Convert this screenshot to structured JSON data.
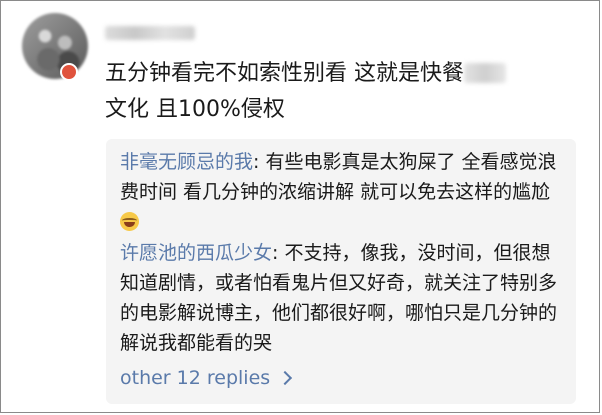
{
  "comment": {
    "text_part1": "五分钟看完不如索性别看 这就是快餐",
    "text_part2": "文化 且100%侵权"
  },
  "replies": [
    {
      "user": "非毫无顾忌的我",
      "text": ": 有些电影真是太狗屎了 全看感觉浪费时间 看几分钟的浓缩讲解 就可以免去这样的尴尬",
      "emoji": "laughing-crying-emoji"
    },
    {
      "user": "许愿池的西瓜少女",
      "text": ": 不支持，像我，没时间，但很想知道剧情，或者怕看鬼片但又好奇，就关注了特别多的电影解说博主，他们都很好啊，哪怕只是几分钟的解说我都能看的哭"
    }
  ],
  "more_replies": {
    "label": "other 12 replies",
    "icon": "chevron-right-icon"
  }
}
